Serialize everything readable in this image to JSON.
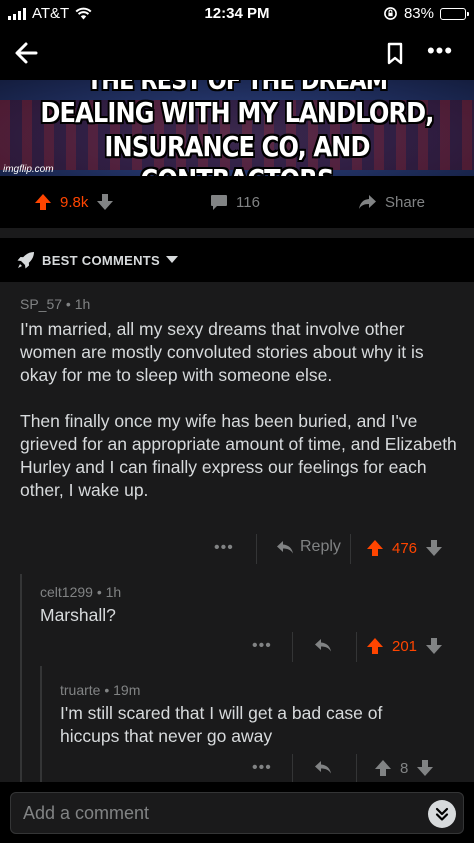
{
  "status_bar": {
    "carrier": "AT&T",
    "time": "12:34 PM",
    "battery": "83%",
    "battery_level": 0.83
  },
  "nav": {
    "back_icon": "arrow-left-icon",
    "save_icon": "bookmark-icon",
    "more_label": "•••"
  },
  "meme": {
    "lines": [
      "THE REST OF THE DREAM",
      "DEALING WITH MY LANDLORD,",
      "INSURANCE CO, AND CONTRACTORS"
    ],
    "watermark": "imgflip.com"
  },
  "post_actions": {
    "score": "9.8k",
    "comment_count": "116",
    "share_label": "Share",
    "upvote_color": "#ff4500"
  },
  "sort": {
    "label": "BEST COMMENTS"
  },
  "comments": [
    {
      "meta": "SP_57 • 1h",
      "paragraphs": [
        "I'm married, all my sexy dreams that involve other women are mostly convoluted stories about why it is okay for me to sleep with someone else.",
        "Then finally once my wife has been buried, and I've grieved for an appropriate amount of time, and Elizabeth Hurley and I can finally express our feelings for each other, I wake up."
      ],
      "more_label": "•••",
      "reply_label": "Reply",
      "score": "476",
      "voted": true
    },
    {
      "meta": "celt1299 • 1h",
      "paragraphs": [
        "Marshall?"
      ],
      "more_label": "•••",
      "score": "201",
      "voted": true
    },
    {
      "meta": "truarte • 19m",
      "paragraphs": [
        "I'm still scared that I will get a bad case of hiccups that never go away"
      ],
      "more_label": "•••",
      "score": "8",
      "voted": false
    }
  ],
  "bottom": {
    "placeholder": "Add a comment"
  },
  "colors": {
    "background": "#000000",
    "card": "#1a1a1b",
    "text": "#d7dadc",
    "muted": "#818384",
    "upvote": "#ff4500"
  }
}
